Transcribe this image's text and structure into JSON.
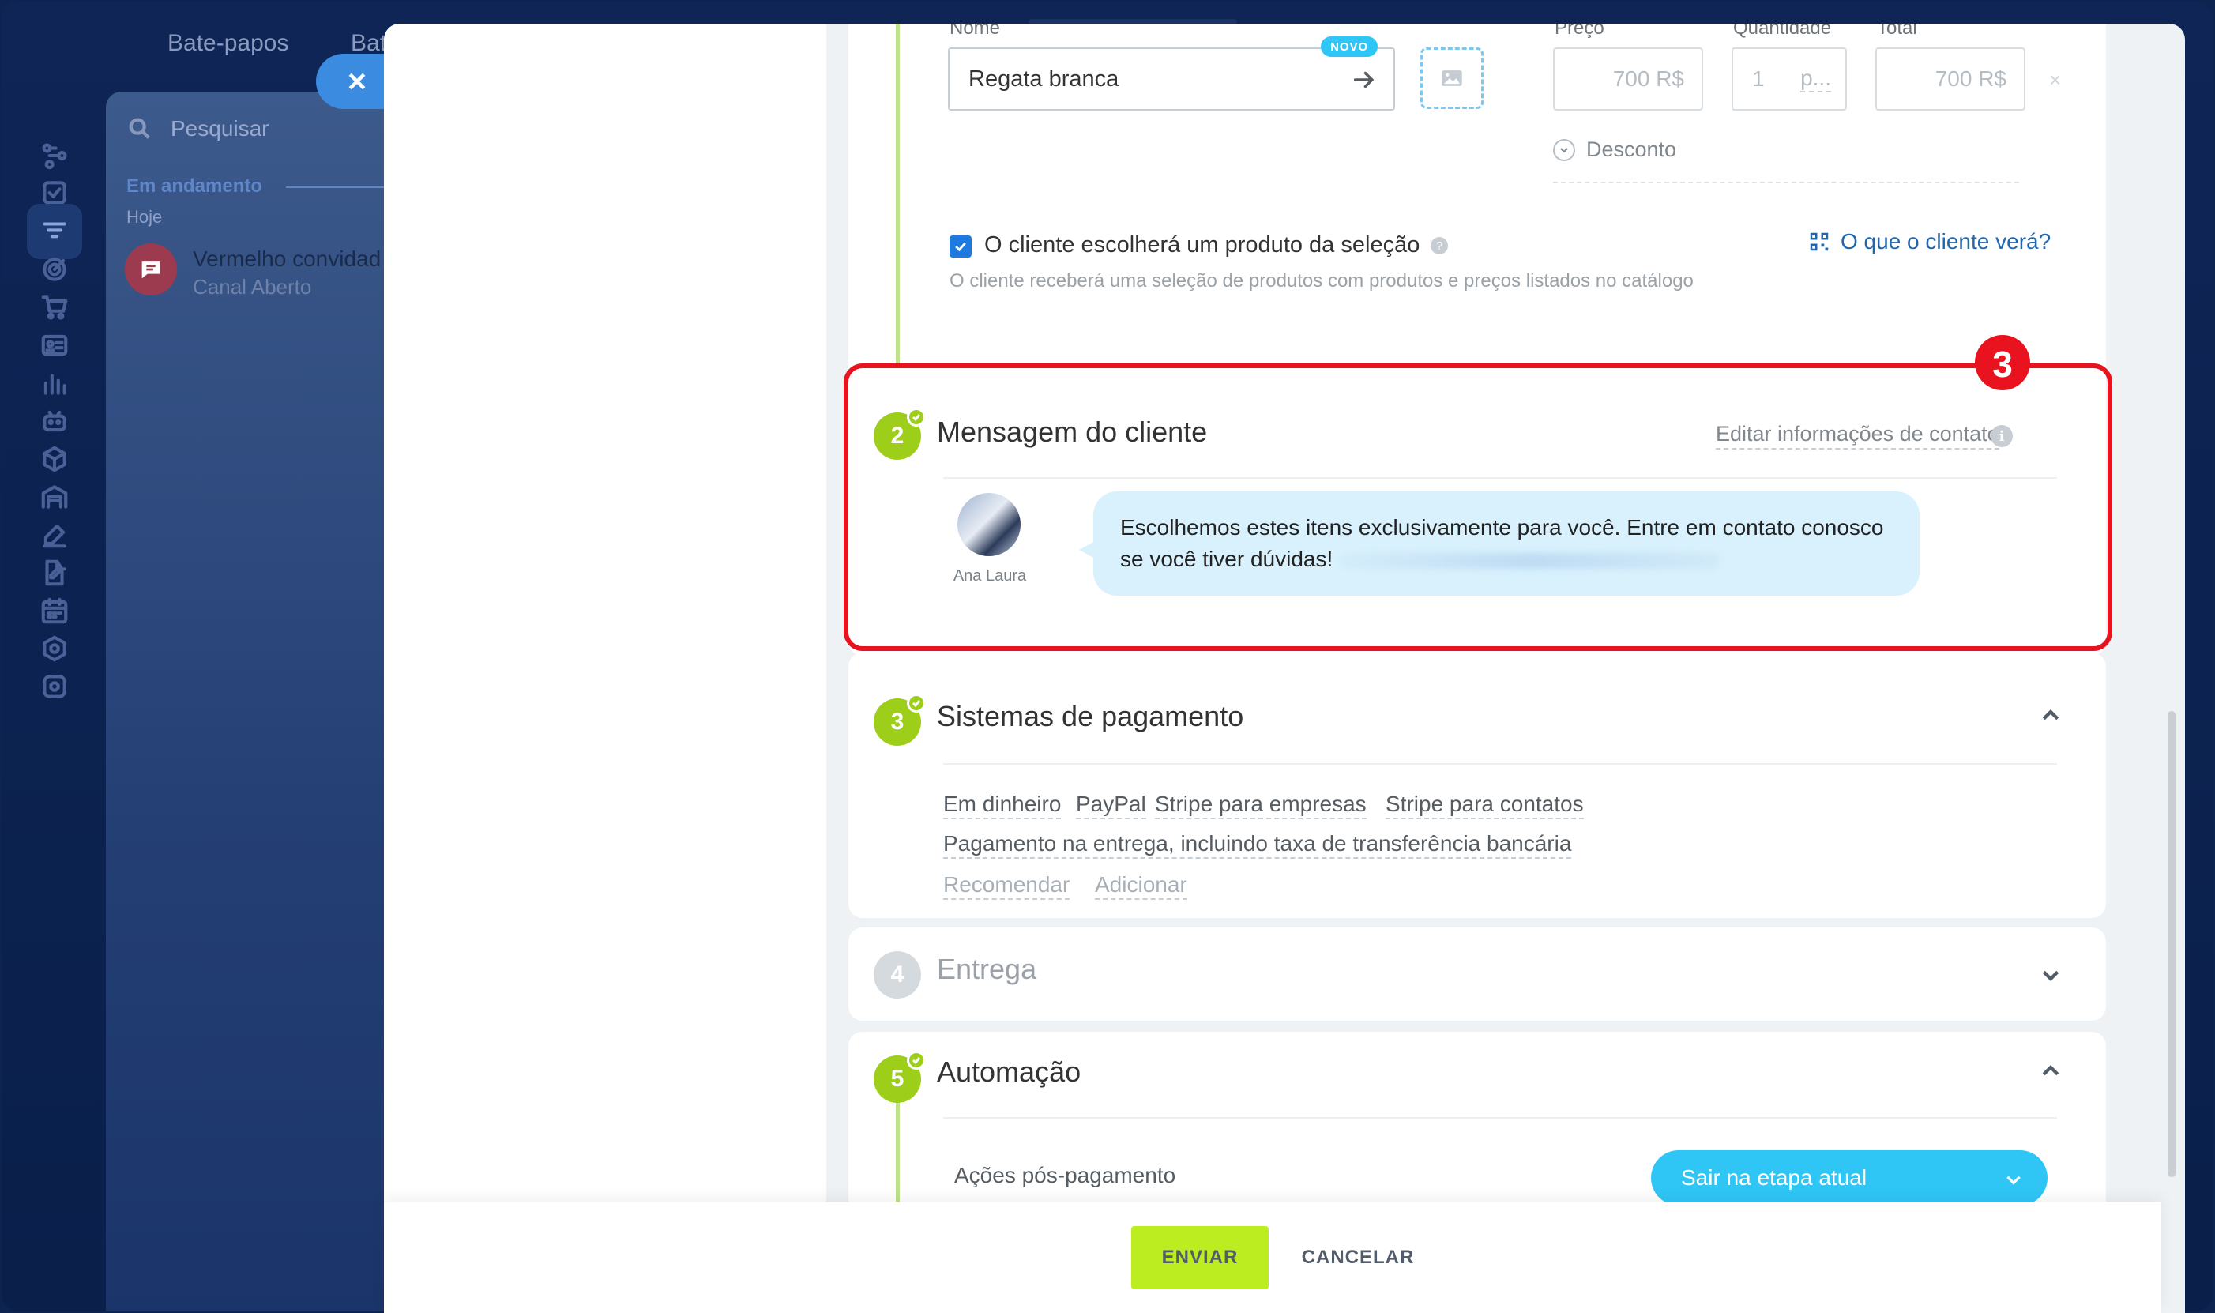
{
  "topbar": {
    "tab_chats": "Bate-papos",
    "tab_second": "Bat"
  },
  "rail": {
    "icons": [
      "routes-icon",
      "task-check-icon",
      "funnel-icon",
      "target-icon",
      "cart-icon",
      "contact-card-icon",
      "chart-bars-icon",
      "robot-icon",
      "cube-icon",
      "warehouse-icon",
      "sign-pen-icon",
      "doc-edit-icon",
      "calendar-grid-icon",
      "hexagon-icon",
      "gear-box-icon"
    ]
  },
  "chat_panel": {
    "search_placeholder": "Pesquisar",
    "section": "Em andamento",
    "day": "Hoje",
    "item": {
      "title": "Vermelho convidad",
      "subtitle": "Canal Aberto"
    }
  },
  "product": {
    "name_label": "Nome",
    "name_value": "Regata branca",
    "new_badge": "NOVO",
    "price_label": "Preço",
    "price_value": "700 R$",
    "qty_label": "Quantidade",
    "qty_value": "1",
    "qty_unit": "p...",
    "total_label": "Total",
    "total_value": "700 R$",
    "discount": "Desconto",
    "remove": "×",
    "checkbox_label": "O cliente escolherá um produto da seleção",
    "checkbox_desc": "O cliente receberá uma seleção de produtos com produtos e preços listados no catálogo",
    "what_client_sees": "O que o cliente verá?",
    "help": "?"
  },
  "message": {
    "step": "2",
    "title": "Mensagem do cliente",
    "edit_contact": "Editar informações de contato",
    "info": "i",
    "agent_name": "Ana Laura",
    "text": "Escolhemos estes itens exclusivamente para você. Entre em contato conosco se você tiver dúvidas!",
    "callout_number": "3"
  },
  "payment": {
    "step": "3",
    "title": "Sistemas de pagamento",
    "methods": [
      "Em dinheiro",
      "PayPal",
      "Stripe para empresas",
      "Stripe para contatos",
      "Pagamento na entrega, incluindo taxa de transferência bancária"
    ],
    "recommend": "Recomendar",
    "add": "Adicionar"
  },
  "delivery": {
    "step": "4",
    "title": "Entrega"
  },
  "automation": {
    "step": "5",
    "title": "Automação",
    "post_payment_label": "Ações pós-pagamento",
    "post_payment_value": "Sair na etapa atual"
  },
  "footer": {
    "send": "ENVIAR",
    "cancel": "CANCELAR"
  },
  "colors": {
    "accent_green": "#9cce1a",
    "send_button": "#bbed21",
    "highlight_red": "#e8131e",
    "link_blue": "#2067b0",
    "select_blue": "#2fc6f6",
    "bubble_bg": "#d8f1fc"
  }
}
